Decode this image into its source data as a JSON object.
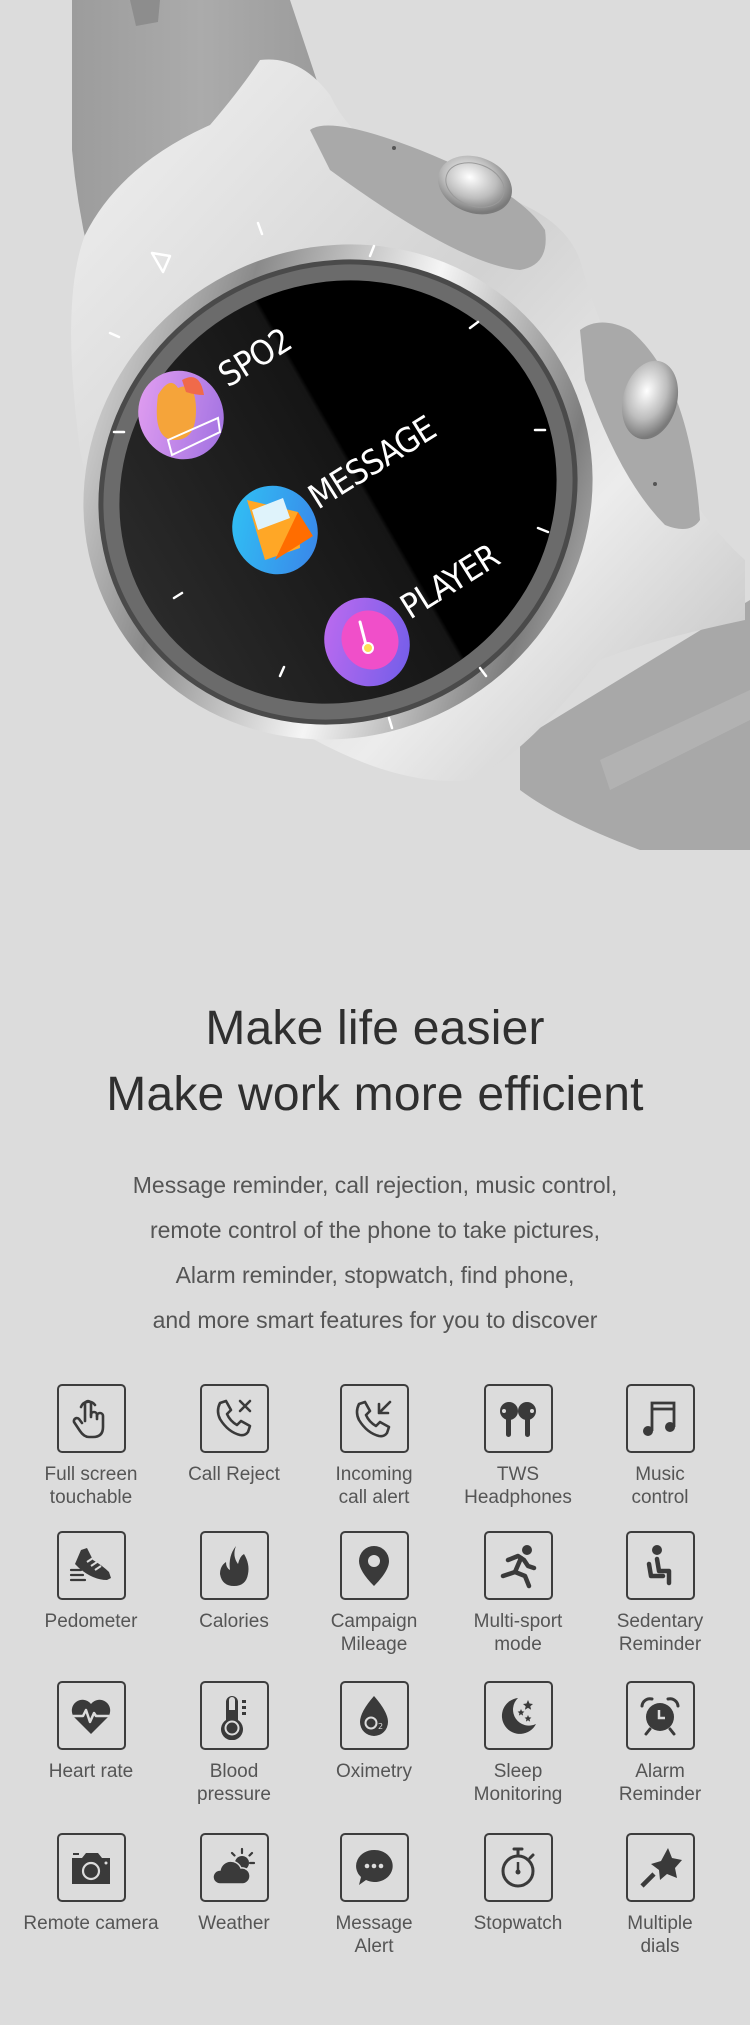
{
  "hero": {
    "watch_screen_items": [
      {
        "label": "SPO2",
        "icon": "spo2-flame-icon"
      },
      {
        "label": "MESSAGE",
        "icon": "envelope-icon"
      },
      {
        "label": "PLAYER",
        "icon": "music-player-icon"
      }
    ],
    "colors": {
      "background": "#dcdcdc",
      "strap": "#a6a6a6",
      "case": "#d9d9d9",
      "screen": "#000000"
    }
  },
  "headline": {
    "line1": "Make life easier",
    "line2": "Make work more efficient"
  },
  "description": {
    "lines": [
      "Message reminder, call rejection, music control,",
      "remote control of the phone to take pictures,",
      "Alarm reminder, stopwatch, find phone,",
      "and more smart features for you to discover"
    ]
  },
  "features": [
    {
      "label": "Full screen\ntouchable",
      "icon": "touch-hand-icon"
    },
    {
      "label": "Call Reject",
      "icon": "call-reject-icon"
    },
    {
      "label": "Incoming\ncall alert",
      "icon": "incoming-call-icon"
    },
    {
      "label": "TWS\nHeadphones",
      "icon": "earbuds-icon"
    },
    {
      "label": "Music\ncontrol",
      "icon": "music-note-icon"
    },
    {
      "label": "Pedometer",
      "icon": "shoe-icon"
    },
    {
      "label": "Calories",
      "icon": "flame-icon"
    },
    {
      "label": "Campaign\nMileage",
      "icon": "location-pin-icon"
    },
    {
      "label": "Multi-sport\nmode",
      "icon": "running-person-icon"
    },
    {
      "label": "Sedentary\nReminder",
      "icon": "seated-person-icon"
    },
    {
      "label": "Heart rate",
      "icon": "heart-pulse-icon"
    },
    {
      "label": "Blood\npressure",
      "icon": "thermometer-icon"
    },
    {
      "label": "Oximetry",
      "icon": "oxygen-drop-icon"
    },
    {
      "label": "Sleep\nMonitoring",
      "icon": "moon-stars-icon"
    },
    {
      "label": "Alarm\nReminder",
      "icon": "alarm-clock-icon"
    },
    {
      "label": "Remote camera",
      "icon": "camera-icon"
    },
    {
      "label": "Weather",
      "icon": "cloud-sun-icon"
    },
    {
      "label": "Message\nAlert",
      "icon": "chat-bubble-icon"
    },
    {
      "label": "Stopwatch",
      "icon": "stopwatch-icon"
    },
    {
      "label": "Multiple\ndials",
      "icon": "magic-wand-icon"
    }
  ]
}
